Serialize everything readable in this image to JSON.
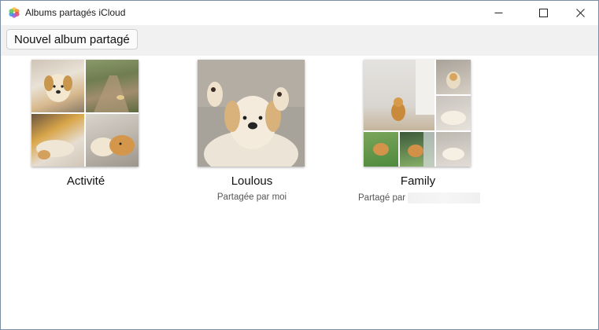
{
  "window": {
    "title": "Albums partagés iCloud",
    "icon": "photos-app-icon",
    "controls": [
      "minimize-icon",
      "maximize-icon",
      "close-icon"
    ]
  },
  "toolbar": {
    "new_album_label": "Nouvel album partagé"
  },
  "albums": [
    {
      "name": "Activité",
      "subtitle": "",
      "layout": "2x2-grid"
    },
    {
      "name": "Loulous",
      "subtitle": "Partagée par moi",
      "layout": "single"
    },
    {
      "name": "Family",
      "subtitle": "Partagé par",
      "layout": "mosaic"
    }
  ]
}
